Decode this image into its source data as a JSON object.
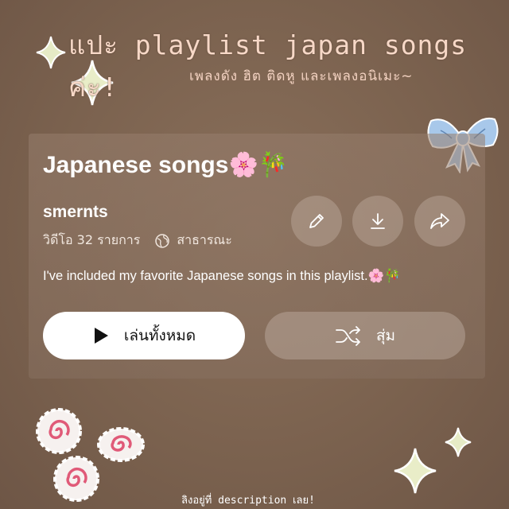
{
  "overlay": {
    "title": "แปะ playlist japan songs ค่ะ!",
    "subtitle": "เพลงดัง ฮิต ติดหู และเพลงอนิเมะ~",
    "footer": "ลิงอยู่ที่ description เลย!"
  },
  "playlist": {
    "title": "Japanese songs🌸🎋",
    "owner": "smernts",
    "video_count": "วิดีโอ 32 รายการ",
    "visibility": "สาธารณะ",
    "description": "I've included my favorite Japanese songs in this playlist.🌸🎋"
  },
  "actions": {
    "edit_icon": "pencil-icon",
    "download_icon": "download-icon",
    "share_icon": "share-icon",
    "play_all_label": "เล่นทั้งหมด",
    "shuffle_label": "สุ่ม"
  },
  "colors": {
    "background": "#7d6450",
    "title_pink": "#f7d8c7",
    "bow_blue": "#a8c8ea",
    "sparkle": "#e9edc8"
  }
}
